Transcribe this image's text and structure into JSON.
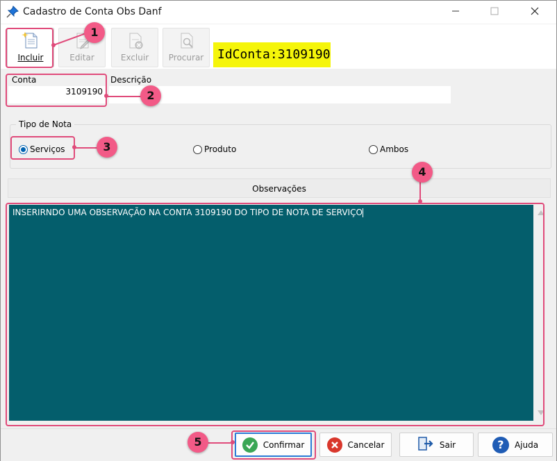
{
  "window": {
    "title": "Cadastro de Conta Obs Danf"
  },
  "toolbar": {
    "incluir_label": "Incluir",
    "editar_label": "Editar",
    "excluir_label": "Excluir",
    "procurar_label": "Procurar",
    "idconta_text": "IdConta:3109190"
  },
  "form": {
    "conta_label": "Conta",
    "conta_value": "3109190",
    "descricao_label": "Descrição",
    "descricao_value": ""
  },
  "tipo_nota": {
    "title": "Tipo  de Nota",
    "options": [
      "Serviços",
      "Produto",
      "Ambos"
    ],
    "selected": "Serviços"
  },
  "observacoes": {
    "header": "Observações",
    "text": "INSERIRNDO UMA OBSERVAÇÃO NA CONTA 3109190 DO TIPO DE NOTA DE SERVIÇO"
  },
  "buttons": {
    "confirmar": "Confirmar",
    "cancelar": "Cancelar",
    "sair": "Sair",
    "ajuda": "Ajuda"
  },
  "annotations": [
    "1",
    "2",
    "3",
    "4",
    "5"
  ],
  "colors": {
    "observacoes_bg": "#045e6c",
    "highlight": "#f5f50a",
    "annotation": "#f25a87"
  }
}
